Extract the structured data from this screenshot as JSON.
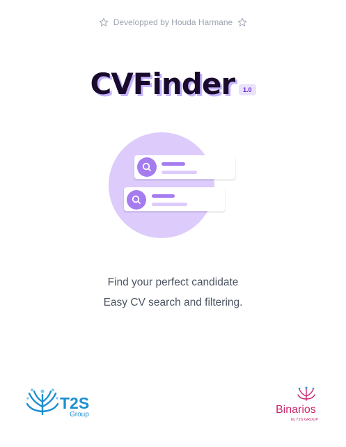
{
  "credit": {
    "text": "Developped by Houda Harmane",
    "icons": [
      "star-outline-icon",
      "star-outline-icon"
    ]
  },
  "app": {
    "name": "CVFinder",
    "version": "1.0"
  },
  "tagline": {
    "line1": "Find your perfect candidate",
    "line2": "Easy CV search and filtering."
  },
  "logos": {
    "left": {
      "name": "T2S",
      "sub": "Group"
    },
    "right": {
      "name": "Binarios",
      "sub": "by T2S GROUP"
    }
  },
  "colors": {
    "accent": "#a57cf0",
    "circle": "#dccbfb",
    "title_shadow": "#c4b5fd",
    "t2s_blue": "#1d8fd0",
    "binarios_pink": "#c8286e"
  }
}
